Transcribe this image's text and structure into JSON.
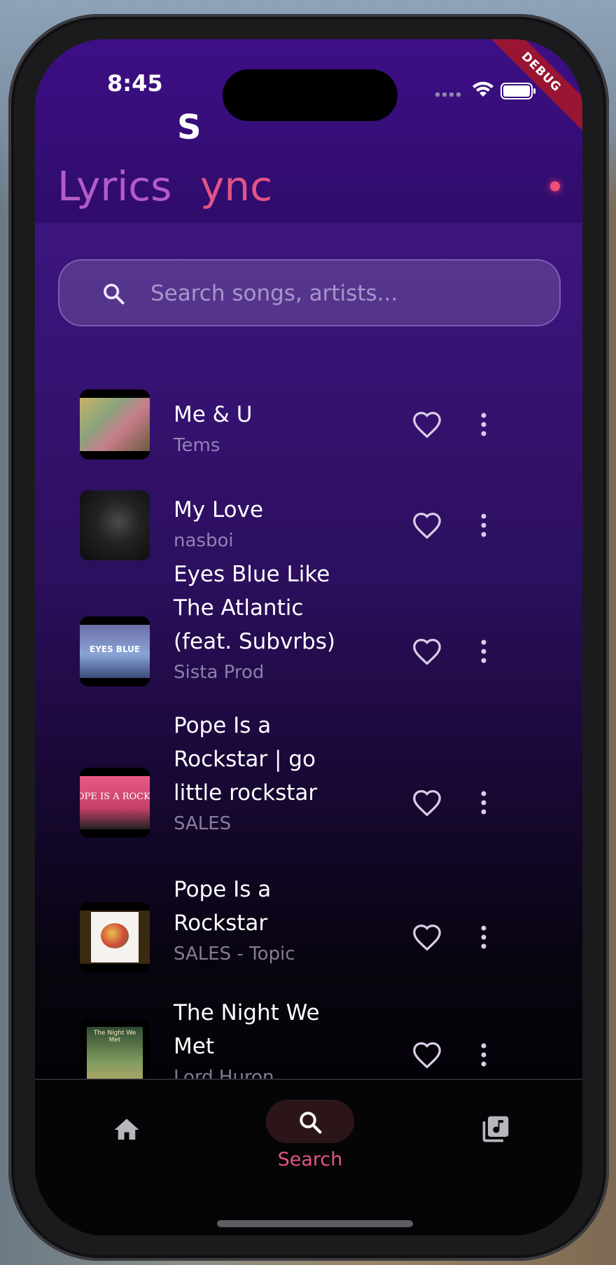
{
  "status": {
    "time": "8:45",
    "debug_label": "DEBUG"
  },
  "header": {
    "logo_s": "S",
    "logo_lyrics": "Lyrics",
    "logo_sync": "ync"
  },
  "search": {
    "placeholder": "Search songs, artists..."
  },
  "songs": [
    {
      "title_lines": [
        "Me & U"
      ],
      "artist": "Tems"
    },
    {
      "title_lines": [
        "My Love"
      ],
      "artist": "nasboi"
    },
    {
      "title_lines": [
        "Eyes Blue Like",
        "The Atlantic",
        "(feat. Subvrbs)"
      ],
      "artist": "Sista Prod",
      "thumb_text": "EYES BLUE"
    },
    {
      "title_lines": [
        "Pope Is a",
        "Rockstar  | go",
        "little rockstar"
      ],
      "artist": "SALES",
      "thumb_text": "OPE IS A ROCKSTA"
    },
    {
      "title_lines": [
        "Pope Is a",
        "Rockstar"
      ],
      "artist": "SALES - Topic"
    },
    {
      "title_lines": [
        "The Night We",
        "Met"
      ],
      "artist": "Lord Huron",
      "thumb_text": "The Night We Met"
    }
  ],
  "nav": {
    "search_label": "Search"
  },
  "colors": {
    "accent": "#e25487",
    "lyrics": "#b35cc7",
    "header": "#3d0f86"
  }
}
